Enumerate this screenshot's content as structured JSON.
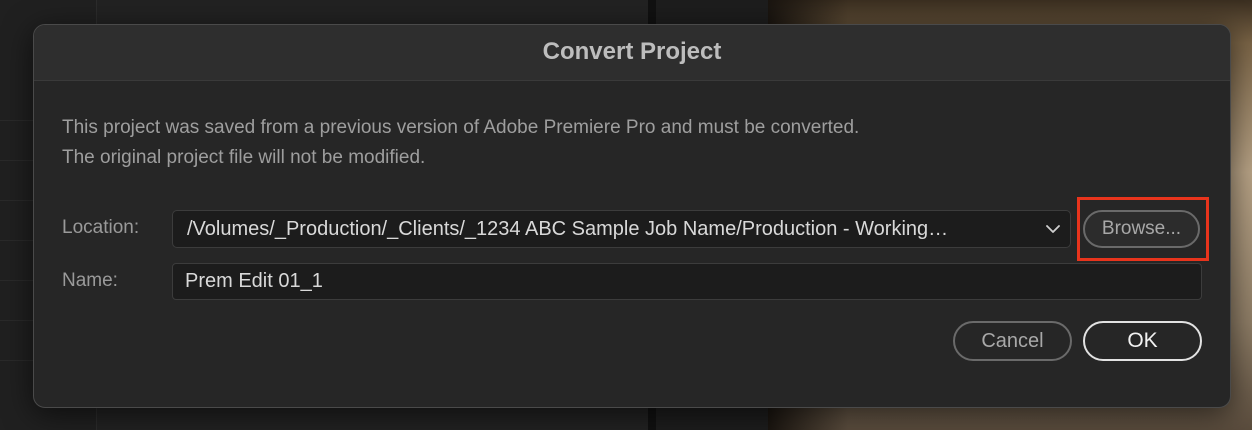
{
  "dialog": {
    "title": "Convert Project",
    "message_line1": "This project was saved from a previous version of Adobe Premiere Pro and must be converted.",
    "message_line2": "The original project file will not be modified.",
    "location": {
      "label": "Location:",
      "value": "/Volumes/_Production/_Clients/_1234 ABC Sample Job Name/Production - Working…",
      "icon": "chevron-down-icon"
    },
    "browse_label": "Browse...",
    "name": {
      "label": "Name:",
      "value": "Prem Edit 01_1"
    },
    "cancel_label": "Cancel",
    "ok_label": "OK"
  },
  "colors": {
    "highlight": "#e8341c",
    "dialog_bg": "#262626",
    "field_bg": "#1c1c1c"
  }
}
